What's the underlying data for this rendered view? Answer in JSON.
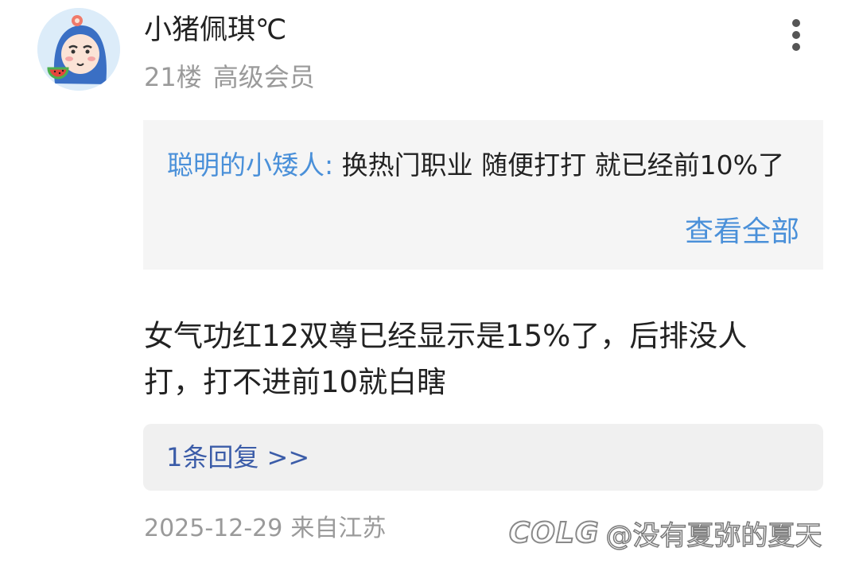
{
  "user": {
    "name": "小猪佩琪℃",
    "floor": "21楼",
    "rank": "高级会员",
    "avatar_icon": "cartoon-avatar-icon"
  },
  "quote": {
    "author": "聪明的小矮人:",
    "text": "换热门职业 随便打打 就已经前10%了",
    "view_all": "查看全部"
  },
  "comment": {
    "text": "女气功红12双尊已经显示是15%了，后排没人打，打不进前10就白瞎"
  },
  "replies": {
    "label": "1条回复 >>"
  },
  "footer": {
    "date": "2025-12-29",
    "location": "来自江苏"
  },
  "watermark": {
    "logo": "COLG",
    "text": "@没有夏弥的夏天"
  },
  "colors": {
    "link_blue": "#4a90d9",
    "reply_blue": "#3b5ca8",
    "muted_gray": "#9a9a9a",
    "quote_bg": "#f5f5f5",
    "reply_bg": "#f0f0f0"
  }
}
